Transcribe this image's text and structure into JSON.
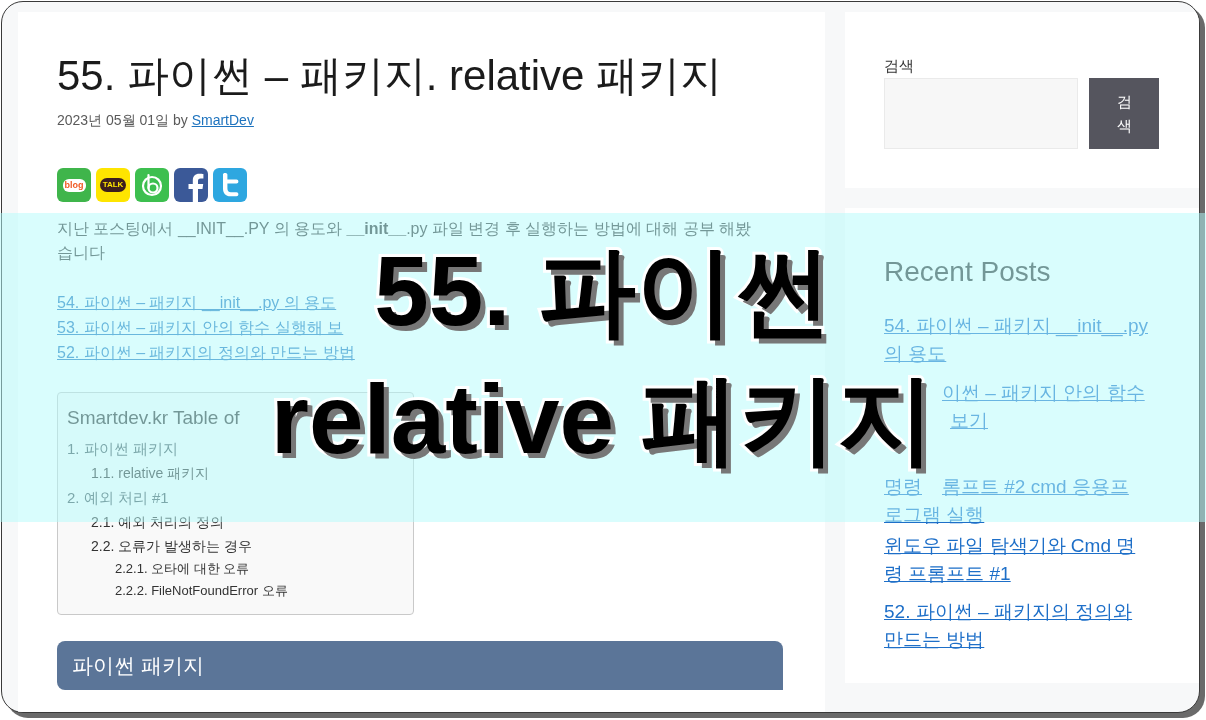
{
  "post": {
    "title": "55. 파이썬 – 패키지. relative 패키지",
    "meta": {
      "date": "2023년 05월 01일",
      "by": "by",
      "author": "SmartDev"
    },
    "share_buttons": [
      {
        "kind": "blog",
        "label": "blog"
      },
      {
        "kind": "talk",
        "label": "TALK"
      },
      {
        "kind": "band"
      },
      {
        "kind": "facebook"
      },
      {
        "kind": "twitter"
      }
    ],
    "intro": "지난 포스팅에서 __INIT__.PY 의 용도와 **__init__**.py 파일 변경 후 실행하는 방법에 대해 공부 해봤습니다",
    "related_links": [
      "54. 파이썬 – 패키지 __init__.py 의 용도",
      "53. 파이썬 – 패키지 안의 함수 실행해 보",
      "52. 파이썬 – 패키지의 정의와 만드는 방법"
    ],
    "toc": {
      "title": "Smartdev.kr Table of",
      "items": [
        {
          "label": "1. 파이썬 패키지",
          "children": [
            {
              "label": "1.1. relative 패키지"
            }
          ]
        },
        {
          "label": "2. 예외 처리 #1",
          "children": [
            {
              "label": "2.1. 예외 처리의 정의"
            },
            {
              "label": "2.2. 오류가 발생하는 경우",
              "children": [
                {
                  "label": "2.2.1. 오타에 대한 오류"
                },
                {
                  "label": "2.2.2. FileNotFoundError 오류"
                }
              ]
            }
          ]
        }
      ]
    },
    "section_heading": "파이썬 패키지"
  },
  "sidebar": {
    "search": {
      "label": "검색",
      "button": "검색"
    },
    "recent_posts": {
      "title": "Recent Posts",
      "items": [
        {
          "kind": "whole",
          "text": "54. 파이썬 – 패키지 __init__.py 의 용도"
        },
        {
          "kind": "covered",
          "lines": [
            [
              "이썬 – 패키지 안의 함수"
            ],
            [
              "보기"
            ]
          ]
        },
        {
          "kind": "covered",
          "lines": [
            [
              "명령",
              "롬프트 #2 cmd 응용프"
            ],
            [
              "로그램 실행"
            ]
          ]
        },
        {
          "kind": "whole",
          "text": "윈도우 파일 탐색기와 Cmd 명령 프롬프트 #1"
        },
        {
          "kind": "whole",
          "text": "52. 파이썬 – 패키지의 정의와 만드는 방법"
        }
      ]
    }
  },
  "banner": {
    "lines": [
      "55. 파이썬",
      "relative 패키지"
    ]
  }
}
